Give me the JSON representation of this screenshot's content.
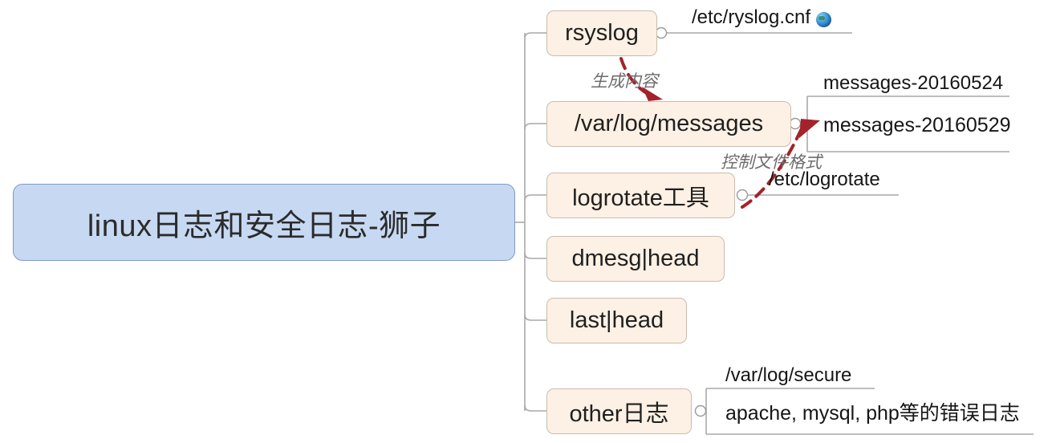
{
  "diagram": {
    "type": "mindmap",
    "title": "linux日志和安全日志-狮子",
    "root": {
      "label": "linux日志和安全日志-狮子",
      "fill": "#c7d9f2",
      "border": "#7d9bc4"
    },
    "branch_style": {
      "fill": "#fdf0e4",
      "border": "#c9bdb0"
    },
    "connector_color": "#a8a8a8",
    "relation_color": "#a4222a",
    "branches": [
      {
        "label": "rsyslog",
        "children": [
          {
            "label": "/etc/ryslog.cnf",
            "icon": "globe-icon",
            "boxed": false
          }
        ]
      },
      {
        "label": "/var/log/messages",
        "children": [
          {
            "label": "messages-20160524",
            "boxed": false
          },
          {
            "label": "messages-20160529",
            "boxed": true
          }
        ]
      },
      {
        "label": "logrotate工具",
        "children": [
          {
            "label": "/etc/logrotate",
            "boxed": false
          }
        ]
      },
      {
        "label": "dmesg|head",
        "children": []
      },
      {
        "label": "last|head",
        "children": []
      },
      {
        "label": "other日志",
        "children": [
          {
            "label": "/var/log/secure",
            "boxed": false
          },
          {
            "label": "apache, mysql, php等的错误日志",
            "boxed": true
          }
        ]
      }
    ],
    "relations": [
      {
        "label": "生成内容",
        "from": "rsyslog",
        "to": "/var/log/messages"
      },
      {
        "label": "控制文件格式",
        "from": "logrotate工具",
        "to": "messages-20160529"
      }
    ]
  }
}
